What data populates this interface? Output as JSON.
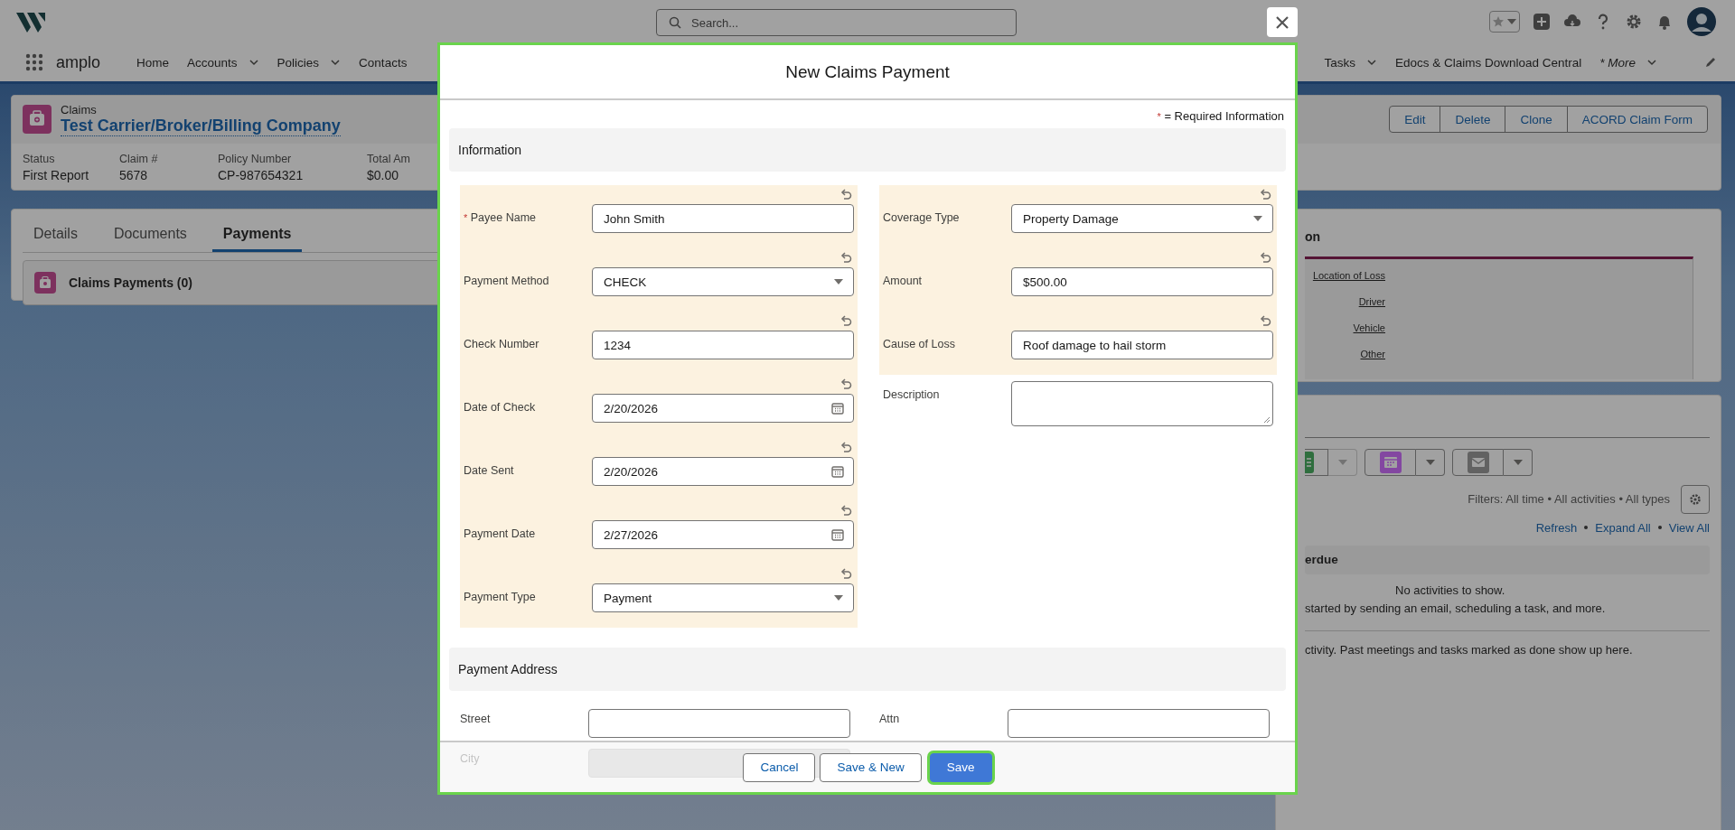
{
  "header": {
    "search": {
      "placeholder": "Search..."
    }
  },
  "nav": {
    "app_name": "amplo",
    "items": [
      {
        "label": "Home",
        "dropdown": false,
        "italic": false
      },
      {
        "label": "Accounts",
        "dropdown": true,
        "italic": false
      },
      {
        "label": "Policies",
        "dropdown": true,
        "italic": false
      },
      {
        "label": "Contacts",
        "dropdown": false,
        "italic": false
      }
    ],
    "right_items": [
      {
        "label": "Tasks",
        "dropdown": true,
        "italic": false
      },
      {
        "label": "Edocs & Claims Download Central",
        "dropdown": false,
        "italic": false
      },
      {
        "label": "* More",
        "dropdown": true,
        "italic": true
      }
    ]
  },
  "record": {
    "object": "Claims",
    "title": "Test Carrier/Broker/Billing Company",
    "actions": [
      "Edit",
      "Delete",
      "Clone",
      "ACORD Claim Form"
    ],
    "fields": [
      {
        "label": "Status",
        "value": "First Report"
      },
      {
        "label": "Claim #",
        "value": "5678"
      },
      {
        "label": "Policy Number",
        "value": "CP-987654321"
      },
      {
        "label": "Total Am",
        "value": "$0.00"
      }
    ]
  },
  "tabs": [
    {
      "label": "Details",
      "selected": false
    },
    {
      "label": "Documents",
      "selected": false
    },
    {
      "label": "Payments",
      "selected": true
    }
  ],
  "related_list": {
    "title": "Claims Payments (0)"
  },
  "side_panel": {
    "heading": "on",
    "links": [
      "Location of Loss",
      "Driver",
      "Vehicle",
      "Other"
    ]
  },
  "activity": {
    "filters": "Filters: All time • All activities • All types",
    "links": [
      "Refresh",
      "Expand All",
      "View All"
    ],
    "section": "erdue",
    "empty": "No activities to show.",
    "hint": "started by sending an email, scheduling a task, and more.",
    "past_note": "ctivity. Past meetings and tasks marked as done show up here."
  },
  "modal": {
    "title": "New Claims Payment",
    "required_mark": "*",
    "required_note": "= Required Information",
    "sections": [
      {
        "title": "Information"
      },
      {
        "title": "Payment Address"
      }
    ],
    "left_fields": [
      {
        "label": "Payee Name",
        "value": "John Smith",
        "kind": "text",
        "required": true,
        "edited": true
      },
      {
        "label": "Payment Method",
        "value": "CHECK",
        "kind": "select",
        "required": false,
        "edited": true
      },
      {
        "label": "Check Number",
        "value": "1234",
        "kind": "text",
        "required": false,
        "edited": true
      },
      {
        "label": "Date of Check",
        "value": "2/20/2026",
        "kind": "date",
        "required": false,
        "edited": true
      },
      {
        "label": "Date Sent",
        "value": "2/20/2026",
        "kind": "date",
        "required": false,
        "edited": true
      },
      {
        "label": "Payment Date",
        "value": "2/27/2026",
        "kind": "date",
        "required": false,
        "edited": true
      },
      {
        "label": "Payment Type",
        "value": "Payment",
        "kind": "select",
        "required": false,
        "edited": true
      }
    ],
    "right_fields": [
      {
        "label": "Coverage Type",
        "value": "Property Damage",
        "kind": "select",
        "required": false,
        "edited": true
      },
      {
        "label": "Amount",
        "value": "$500.00",
        "kind": "text",
        "required": false,
        "edited": true
      },
      {
        "label": "Cause of Loss",
        "value": "Roof damage to hail storm",
        "kind": "text",
        "required": false,
        "edited": true
      },
      {
        "label": "Description",
        "kind": "textarea",
        "required": false,
        "edited": false
      }
    ],
    "address_fields": [
      {
        "label": "Street",
        "disabled": false
      },
      {
        "label": "Attn",
        "disabled": false
      },
      {
        "label": "City",
        "disabled": true
      }
    ],
    "buttons": [
      {
        "label": "Cancel",
        "kind": "neutral",
        "focused": false
      },
      {
        "label": "Save & New",
        "kind": "neutral",
        "focused": false
      },
      {
        "label": "Save",
        "kind": "brand",
        "focused": true
      }
    ]
  }
}
